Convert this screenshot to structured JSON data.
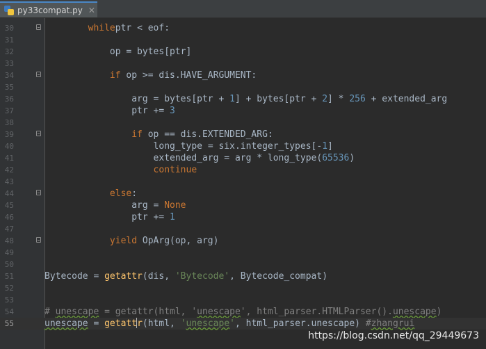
{
  "tab": {
    "filename": "py33compat.py",
    "close_glyph": "✕"
  },
  "lines": [
    {
      "n": "30",
      "indent": "        ",
      "tokens": [
        [
          "kw",
          "while"
        ],
        [
          "",
          "ptr < eof:"
        ]
      ]
    },
    {
      "n": "31",
      "indent": "",
      "tokens": []
    },
    {
      "n": "32",
      "indent": "            ",
      "tokens": [
        [
          "",
          "op = bytes[ptr]"
        ]
      ]
    },
    {
      "n": "33",
      "indent": "",
      "tokens": []
    },
    {
      "n": "34",
      "indent": "            ",
      "tokens": [
        [
          "kw",
          "if"
        ],
        [
          "",
          " op >= dis.HAVE_ARGUMENT:"
        ]
      ]
    },
    {
      "n": "35",
      "indent": "",
      "tokens": []
    },
    {
      "n": "36",
      "indent": "                ",
      "tokens": [
        [
          "",
          "arg = bytes[ptr + "
        ],
        [
          "num",
          "1"
        ],
        [
          "",
          "] + bytes[ptr + "
        ],
        [
          "num",
          "2"
        ],
        [
          "",
          "] * "
        ],
        [
          "num",
          "256"
        ],
        [
          "",
          " + extended_arg"
        ]
      ]
    },
    {
      "n": "37",
      "indent": "                ",
      "tokens": [
        [
          "",
          "ptr += "
        ],
        [
          "num",
          "3"
        ]
      ]
    },
    {
      "n": "38",
      "indent": "",
      "tokens": []
    },
    {
      "n": "39",
      "indent": "                ",
      "tokens": [
        [
          "kw",
          "if"
        ],
        [
          "",
          " op == dis.EXTENDED_ARG:"
        ]
      ]
    },
    {
      "n": "40",
      "indent": "                    ",
      "tokens": [
        [
          "",
          "long_type = six.integer_types[-"
        ],
        [
          "num",
          "1"
        ],
        [
          "",
          "]"
        ]
      ]
    },
    {
      "n": "41",
      "indent": "                    ",
      "tokens": [
        [
          "",
          "extended_arg = arg * long_type("
        ],
        [
          "num",
          "65536"
        ],
        [
          "",
          ")"
        ]
      ]
    },
    {
      "n": "42",
      "indent": "                    ",
      "tokens": [
        [
          "kw",
          "continue"
        ]
      ]
    },
    {
      "n": "43",
      "indent": "",
      "tokens": []
    },
    {
      "n": "44",
      "indent": "            ",
      "tokens": [
        [
          "kw",
          "else"
        ],
        [
          "",
          ":"
        ]
      ]
    },
    {
      "n": "45",
      "indent": "                ",
      "tokens": [
        [
          "",
          "arg = "
        ],
        [
          "kw",
          "None"
        ]
      ]
    },
    {
      "n": "46",
      "indent": "                ",
      "tokens": [
        [
          "",
          "ptr += "
        ],
        [
          "num",
          "1"
        ]
      ]
    },
    {
      "n": "47",
      "indent": "",
      "tokens": []
    },
    {
      "n": "48",
      "indent": "            ",
      "tokens": [
        [
          "kw",
          "yield"
        ],
        [
          "",
          " OpArg(op, arg)"
        ]
      ]
    },
    {
      "n": "49",
      "indent": "",
      "tokens": []
    },
    {
      "n": "50",
      "indent": "",
      "tokens": []
    },
    {
      "n": "51",
      "indent": "",
      "tokens": [
        [
          "",
          "Bytecode = "
        ],
        [
          "fn",
          "getattr"
        ],
        [
          "",
          "(dis, "
        ],
        [
          "str",
          "'Bytecode'"
        ],
        [
          "",
          ", Bytecode_compat)"
        ]
      ]
    },
    {
      "n": "52",
      "indent": "",
      "tokens": []
    },
    {
      "n": "53",
      "indent": "",
      "tokens": []
    },
    {
      "n": "54",
      "indent": "",
      "tokens": [
        [
          "cm",
          "# "
        ],
        [
          "cm warn",
          "unescape"
        ],
        [
          "cm",
          " = getattr(html, '"
        ],
        [
          "cm warn",
          "unescape"
        ],
        [
          "cm",
          "', html_parser.HTMLParser()."
        ],
        [
          "cm warn",
          "unescape"
        ],
        [
          "cm",
          ")"
        ]
      ]
    },
    {
      "n": "55",
      "indent": "",
      "current": true,
      "tokens": [
        [
          "warn",
          "unescape"
        ],
        [
          "",
          " = "
        ],
        [
          "fn",
          "getatt"
        ],
        [
          "caret",
          ""
        ],
        [
          "fn",
          "r"
        ],
        [
          "",
          "(html, "
        ],
        [
          "str",
          "'"
        ],
        [
          "str warn",
          "unescape"
        ],
        [
          "str",
          "'"
        ],
        [
          "",
          ", html_parser.unescape) "
        ],
        [
          "cm",
          "#"
        ],
        [
          "cm warn",
          "zhangrui"
        ]
      ]
    }
  ],
  "watermark": "https://blog.csdn.net/qq_29449673"
}
